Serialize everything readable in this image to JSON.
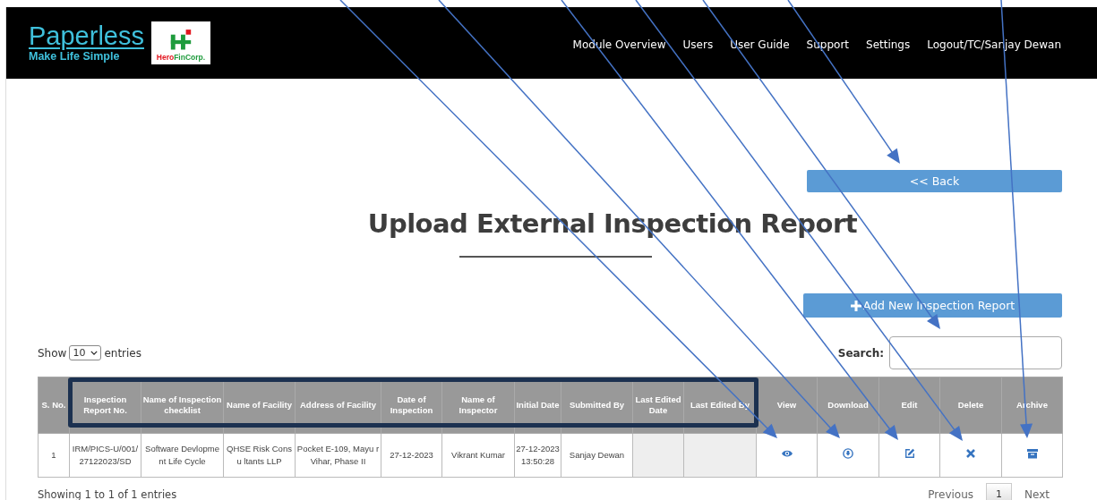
{
  "brand": {
    "name": "Paperless",
    "tagline": "Make Life Simple",
    "partner_logo": {
      "part_1": "Hero",
      "part_2": "FinCorp."
    }
  },
  "nav": [
    "Module Overview",
    "Users",
    "User Guide",
    "Support",
    "Settings",
    "Logout/TC/Sanjay Dewan"
  ],
  "back_button": "<< Back",
  "title": "Upload External Inspection Report",
  "add_button": "Add New Inspection Report",
  "length_menu": {
    "prefix": "Show",
    "value": "10",
    "suffix": "entries"
  },
  "search": {
    "label": "Search:"
  },
  "table": {
    "columns": [
      "S. No.",
      "Inspection Report No.",
      "Name of Inspection checklist",
      "Name of Facility",
      "Address of Facility",
      "Date of Inspection",
      "Name of Inspector",
      "Initial Date",
      "Submitted By",
      "Last Edited Date",
      "Last Edited By",
      "View",
      "Download",
      "Edit",
      "Delete",
      "Archive"
    ],
    "rows": [
      {
        "cells": [
          "1",
          "IRM/PICS-U/001/ 27122023/SD",
          "Software Devlopme nt Life Cycle",
          "QHSE Risk Consu ltants LLP",
          "Pocket E-109, Mayu r Vihar, Phase II",
          "27-12-2023",
          "Vikrant Kumar",
          "27-12-2023 13:50:28",
          "Sanjay Dewan",
          null,
          null
        ],
        "actions": [
          {
            "kind": "view"
          },
          {
            "kind": "download"
          },
          {
            "kind": "edit"
          },
          {
            "kind": "delete"
          },
          {
            "kind": "archive"
          }
        ]
      }
    ]
  },
  "info": "Showing 1 to 1 of 1 entries",
  "pagination": {
    "previous": "Previous",
    "pages": [
      {
        "label": "1",
        "selected": true
      }
    ],
    "next": "Next"
  }
}
